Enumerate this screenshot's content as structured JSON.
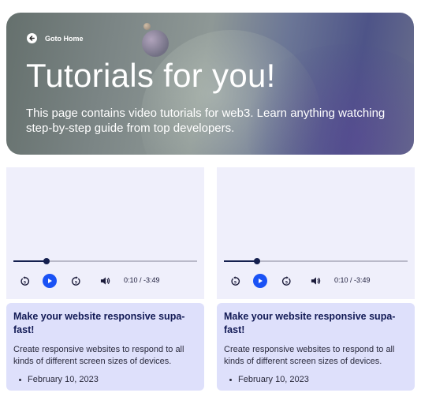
{
  "hero": {
    "back_label": "Goto Home",
    "title": "Tutorials for you!",
    "description": "This page contains video tutorials for web3. Learn anything watching step-by-step guide from top developers."
  },
  "colors": {
    "accent": "#1a52f5",
    "progress": "#15204f",
    "video_bg": "#efeffb",
    "card_bg": "#dee0fb"
  },
  "videos": [
    {
      "time": "0:10 / -3:49",
      "progress": 0.18,
      "title": "Make your website responsive supa-fast!",
      "description": "Create responsive websites to respond to all kinds of different screen sizes of devices.",
      "date": "February 10, 2023"
    },
    {
      "time": "0:10 / -3:49",
      "progress": 0.18,
      "title": "Make your website responsive supa-fast!",
      "description": "Create responsive websites to respond to all kinds of different screen sizes of devices.",
      "date": "February 10, 2023"
    }
  ]
}
